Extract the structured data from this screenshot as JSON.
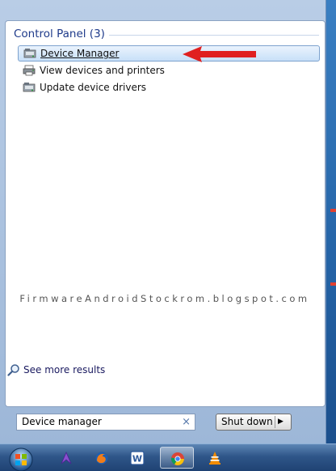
{
  "start_menu": {
    "group_header": "Control Panel (3)",
    "results": [
      {
        "label": "Device Manager",
        "icon": "device-manager-icon",
        "selected": true
      },
      {
        "label": "View devices and printers",
        "icon": "devices-printers-icon",
        "selected": false
      },
      {
        "label": "Update device drivers",
        "icon": "update-drivers-icon",
        "selected": false
      }
    ],
    "watermark": "FirmwareAndroidStockrom.blogspot.com",
    "see_more": "See more results",
    "search": {
      "value": "Device manager",
      "clear": "×"
    },
    "shutdown": {
      "label": "Shut down",
      "arrow": "▶"
    }
  },
  "annotation": {
    "type": "arrow",
    "color": "#e02020",
    "points_to": "Device Manager"
  },
  "taskbar": {
    "items": [
      {
        "icon": "windows-start-orb-icon"
      },
      {
        "icon": "app-icon"
      },
      {
        "icon": "firefox-icon"
      },
      {
        "icon": "word-icon",
        "text": "W"
      },
      {
        "icon": "chrome-icon",
        "active": true
      },
      {
        "icon": "vlc-icon"
      }
    ]
  },
  "colors": {
    "accent": "#1e3a8a",
    "selection": "#c8e0f8",
    "taskbar": "#2f5689"
  }
}
